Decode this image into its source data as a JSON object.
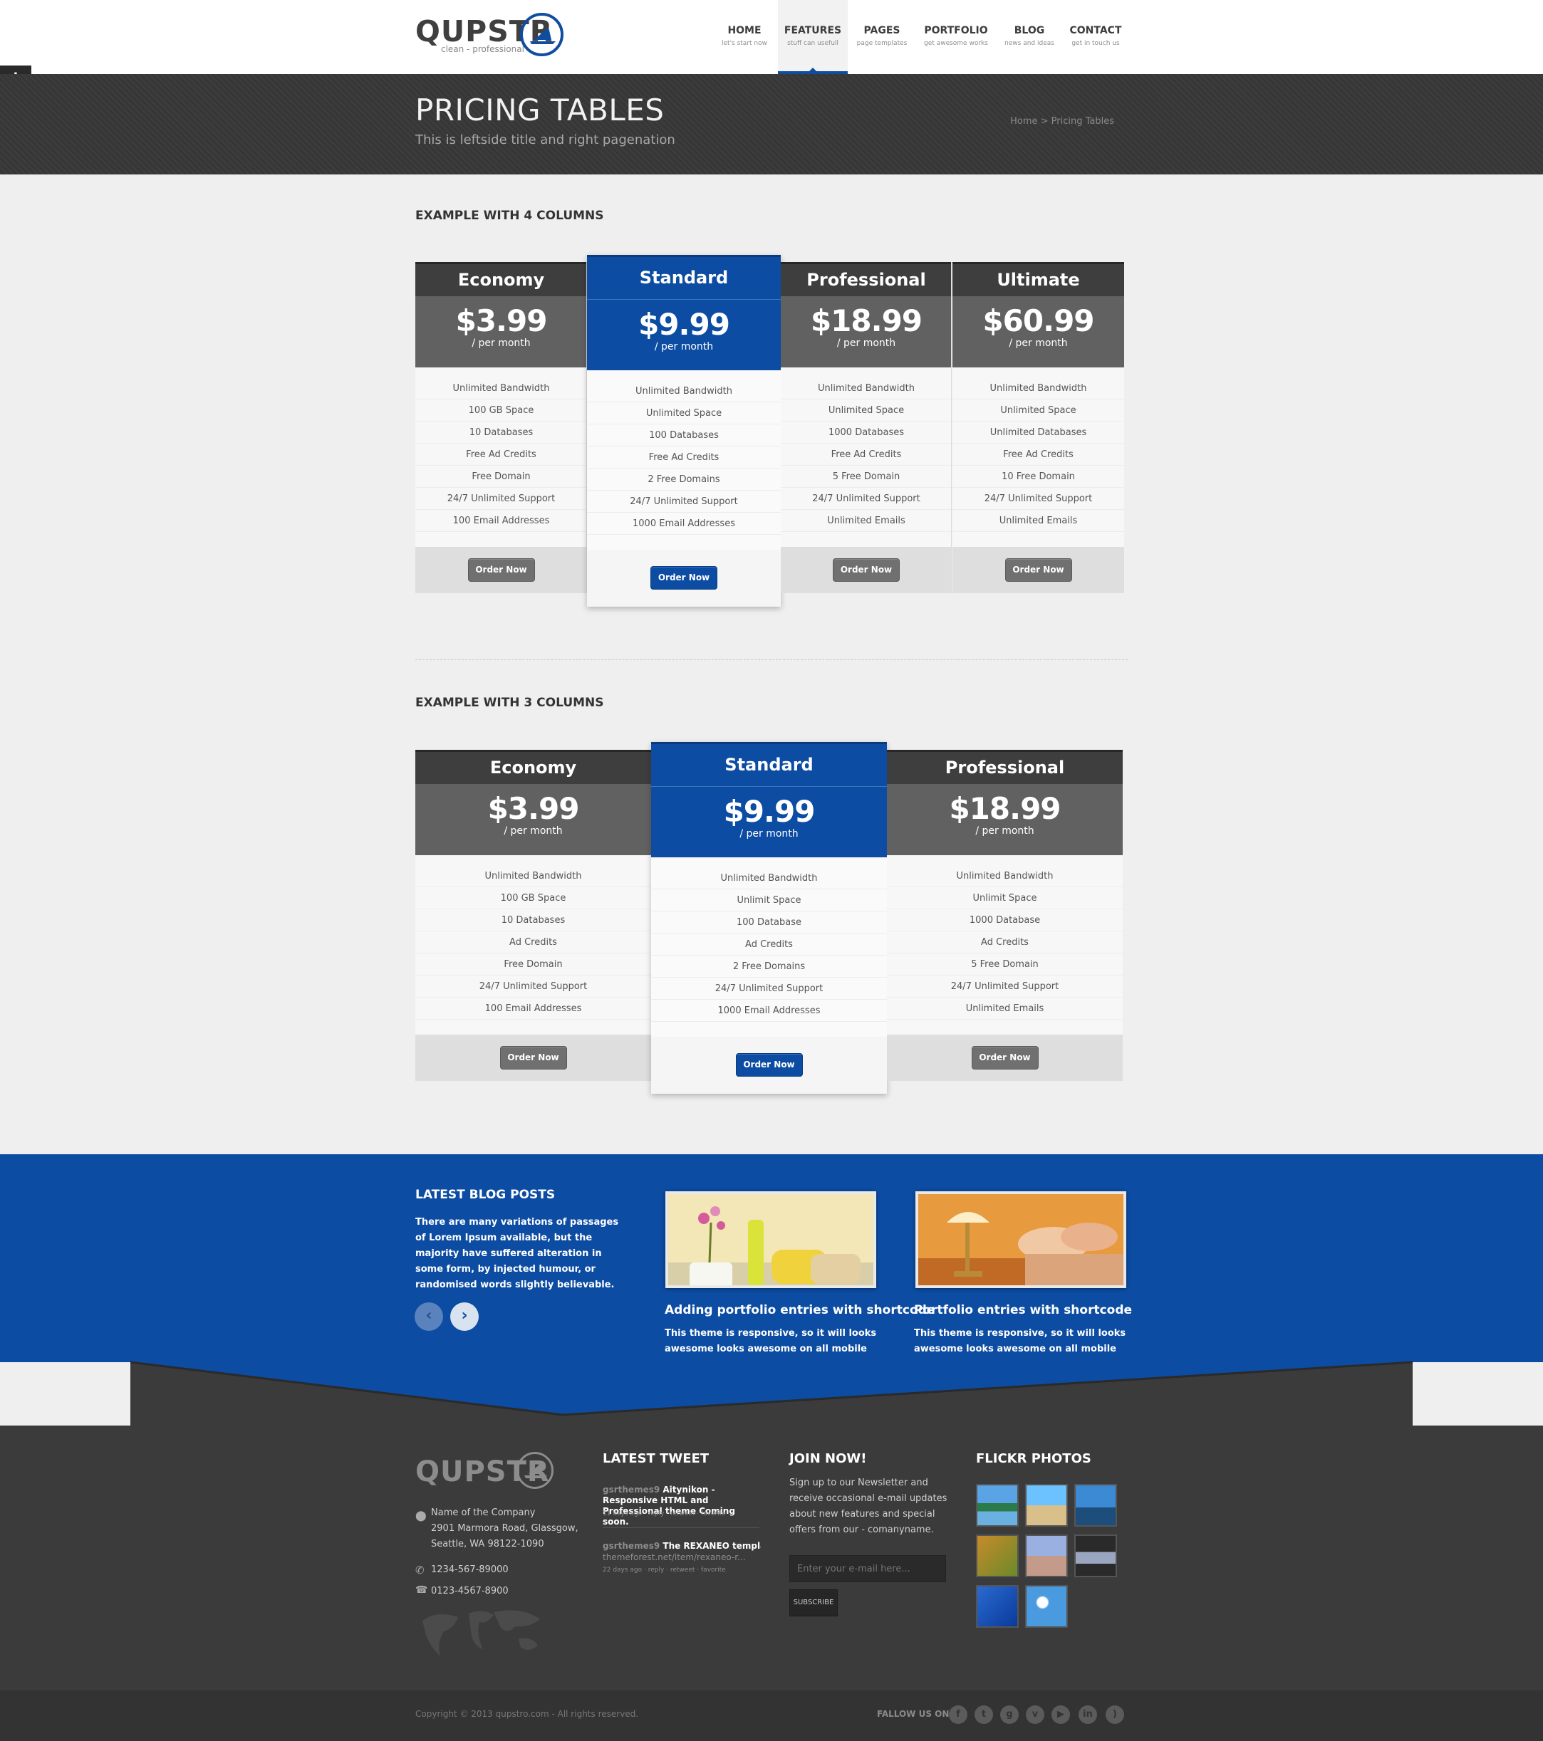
{
  "logo": {
    "text": "QUPSTR",
    "tagline": "clean - professional"
  },
  "nav": [
    {
      "label": "HOME",
      "sub": "let's start now"
    },
    {
      "label": "FEATURES",
      "sub": "stuff can usefull"
    },
    {
      "label": "PAGES",
      "sub": "page templates"
    },
    {
      "label": "PORTFOLIO",
      "sub": "get awesome works"
    },
    {
      "label": "BLOG",
      "sub": "news and ideas"
    },
    {
      "label": "CONTACT",
      "sub": "get in touch us"
    }
  ],
  "page": {
    "title": "PRICING TABLES",
    "subtitle": "This is leftside title and right pagenation",
    "breadcrumb": "Home > Pricing Tables"
  },
  "sections": {
    "four": "EXAMPLE WITH 4 COLUMNS",
    "three": "EXAMPLE WITH 3 COLUMNS"
  },
  "per_month": "/ per month",
  "order_label": "Order Now",
  "pricing4": [
    {
      "name": "Economy",
      "price": "$3.99",
      "features": [
        "Unlimited Bandwidth",
        "100 GB Space",
        "10 Databases",
        "Free Ad Credits",
        "Free Domain",
        "24/7 Unlimited Support",
        "100 Email Addresses"
      ]
    },
    {
      "name": "Standard",
      "price": "$9.99",
      "features": [
        "Unlimited Bandwidth",
        "Unlimited Space",
        "100 Databases",
        "Free Ad Credits",
        "2 Free Domains",
        "24/7 Unlimited Support",
        "1000 Email Addresses"
      ]
    },
    {
      "name": "Professional",
      "price": "$18.99",
      "features": [
        "Unlimited Bandwidth",
        "Unlimited Space",
        "1000 Databases",
        "Free Ad Credits",
        "5 Free Domain",
        "24/7 Unlimited Support",
        "Unlimited Emails"
      ]
    },
    {
      "name": "Ultimate",
      "price": "$60.99",
      "features": [
        "Unlimited Bandwidth",
        "Unlimited Space",
        "Unlimited Databases",
        "Free Ad Credits",
        "10 Free Domain",
        "24/7 Unlimited Support",
        "Unlimited Emails"
      ]
    }
  ],
  "pricing3": [
    {
      "name": "Economy",
      "price": "$3.99",
      "features": [
        "Unlimited Bandwidth",
        "100 GB Space",
        "10 Databases",
        "Ad Credits",
        "Free Domain",
        "24/7 Unlimited Support",
        "100 Email Addresses"
      ]
    },
    {
      "name": "Standard",
      "price": "$9.99",
      "features": [
        "Unlimited Bandwidth",
        "Unlimit Space",
        "100 Database",
        "Ad Credits",
        "2 Free Domains",
        "24/7 Unlimited Support",
        "1000 Email Addresses"
      ]
    },
    {
      "name": "Professional",
      "price": "$18.99",
      "features": [
        "Unlimited Bandwidth",
        "Unlimit Space",
        "1000 Database",
        "Ad Credits",
        "5 Free Domain",
        "24/7 Unlimited Support",
        "Unlimited Emails"
      ]
    }
  ],
  "blog": {
    "heading": "LATEST BLOG POSTS",
    "intro": "There are many variations of passages of Lorem Ipsum available, but the majority have suffered alteration in some form, by injected humour, or randomised words slightly believable.",
    "posts": [
      {
        "title": "Adding portfolio entries with shortcode",
        "text": "This theme is responsive, so it will looks awesome looks awesome on all mobile devices."
      },
      {
        "title": "Portfolio entries with shortcode",
        "text": "This theme is responsive, so it will looks awesome looks awesome on all mobile devices."
      }
    ]
  },
  "footer": {
    "logo": "QUPSTR",
    "address": [
      "Name of the Company",
      "2901 Marmora Road, Glassgow,",
      "Seattle, WA 98122-1090"
    ],
    "phone": "1234-567-89000",
    "fax": "0123-4567-8900",
    "tweet_heading": "LATEST TWEET",
    "tweets": [
      {
        "user": "gsrthemes9",
        "text": "Aitynikon - Responsive HTML and Professional theme Coming soon.",
        "meta": "11 days ago · reply · retweet · favorite"
      },
      {
        "user": "gsrthemes9",
        "text": "The REXANEO template o",
        "link": "themeforest.net/item/rexaneo-r...",
        "meta": "22 days ago · reply · retweet · favorite"
      }
    ],
    "join_heading": "JOIN NOW!",
    "join_text": "Sign up to our Newsletter and receive occasional e-mail updates about new features and special offers from our - comanyname.",
    "email_placeholder": "Enter your e-mail here...",
    "subscribe": "SUBSCRIBE",
    "flickr_heading": "FLICKR PHOTOS",
    "copyright": "Copyright © 2013 qupstro.com - All rights reserved.",
    "follow": "FALLOW US ON:",
    "social": [
      "facebook-icon",
      "twitter-icon",
      "google-plus-icon",
      "vimeo-icon",
      "youtube-icon",
      "linkedin-icon",
      "rss-icon"
    ]
  }
}
